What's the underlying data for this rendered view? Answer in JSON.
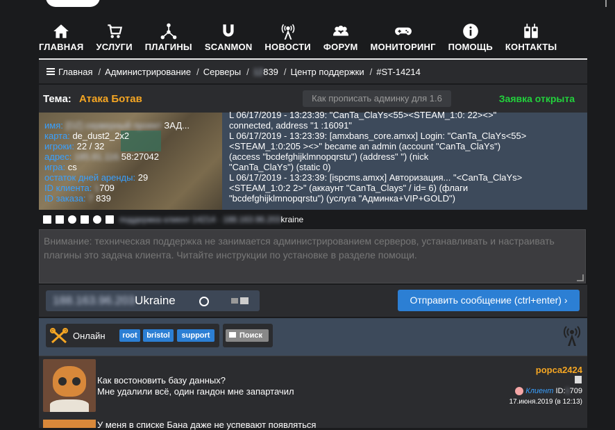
{
  "nav": [
    {
      "label": "ГЛАВНАЯ",
      "icon": "home-icon"
    },
    {
      "label": "УСЛУГИ",
      "icon": "cart-icon"
    },
    {
      "label": "ПЛАГИНЫ",
      "icon": "network-icon"
    },
    {
      "label": "SCANMON",
      "icon": "magnet-icon"
    },
    {
      "label": "НОВОСТИ",
      "icon": "antenna-icon"
    },
    {
      "label": "ФОРУМ",
      "icon": "users-icon"
    },
    {
      "label": "МОНИТОРИНГ",
      "icon": "gamepad-icon"
    },
    {
      "label": "ПОМОЩЬ",
      "icon": "info-icon"
    },
    {
      "label": "КОНТАКТЫ",
      "icon": "phones-icon"
    }
  ],
  "breadcrumb": {
    "home": "Главная",
    "admin": "Администрирование",
    "servers": "Серверы",
    "server_id": "839",
    "support": "Центр поддержки",
    "ticket": "#ST-14214"
  },
  "topic": {
    "label": "Тема:",
    "name": "Атака Ботав",
    "subject": "Как прописать админку для 1.6",
    "status": "Заявка открыта",
    "status_color": "#22d23c"
  },
  "server": {
    "name_label": "имя:",
    "map_label": "карта:",
    "map": "de_dust2_2x2",
    "players_label": "игроки:",
    "players": "22 / 32",
    "addr_label": "адрес:",
    "addr": "58:27042",
    "game_label": "игра:",
    "game": "cs",
    "days_label": "остаток дней аренды:",
    "days": "29",
    "client_label": "ID клиента:",
    "client": "709",
    "order_label": "ID заказа:",
    "order": "839",
    "name_suffix": "ЗАД..."
  },
  "log": [
    "L 06/17/2019 - 13:23:39: \"CanTa_ClaYs<55><STEAM_1:0:          22><>\"",
    "connected, address \"1               :16091\"",
    "L 06/17/2019 - 13:23:39: [amxbans_core.amxx] Login: \"CanTa_ClaYs<55>",
    "<STEAM_1:0:205          ><>\" became an admin (account \"CanTa_ClaYs\")",
    "(access \"bcdefghijklmnopqrstu\") (address\"              \") (nick",
    "\"CanTa_ClaYs\") (static 0)",
    "L 06/17/2019 - 13:23:39: [ispcms.amxx] Авторизация... \"<CanTa_ClaYs>",
    "<STEAM_1:0:2               2>\" (аккаунт \"CanTa_Clays\" / id= 6) (флаги",
    "\"bcdefghijklmnopqrstu\") (услуга \"Админка+VIP+GOLD\")"
  ],
  "tools": {
    "blurred": "поддержка клиент 14214 · 188.163.96.203",
    "suffix": "kraine"
  },
  "message": {
    "placeholder": "Внимание: техническая поддержка не занимается администрированием серверов, устанавливать и настраивать плагины это задача клиента. Читайте инструкции по установке в разделе помощи."
  },
  "controls": {
    "ip_blur": "188.163.96.203",
    "ip_suffix": "Ukraine",
    "send": "Отправить сообщение (ctrl+enter) ›"
  },
  "status": {
    "online": "Онлайн",
    "tags": [
      "root",
      "bristol",
      "support"
    ],
    "search": "Поиск",
    "accent": "#2c7fd4"
  },
  "post": {
    "user": "popca2424",
    "line1": "Как востоновить базу данных?",
    "line2": "Мне удалили всё, один гандон мне запартачил",
    "client_label": "Клиент",
    "id_label": "ID:",
    "id": "709",
    "date": "17.июня.2019 (в 12:13)"
  },
  "post2": {
    "line1": "У меня в списке Бана даже не успевают появляться"
  }
}
